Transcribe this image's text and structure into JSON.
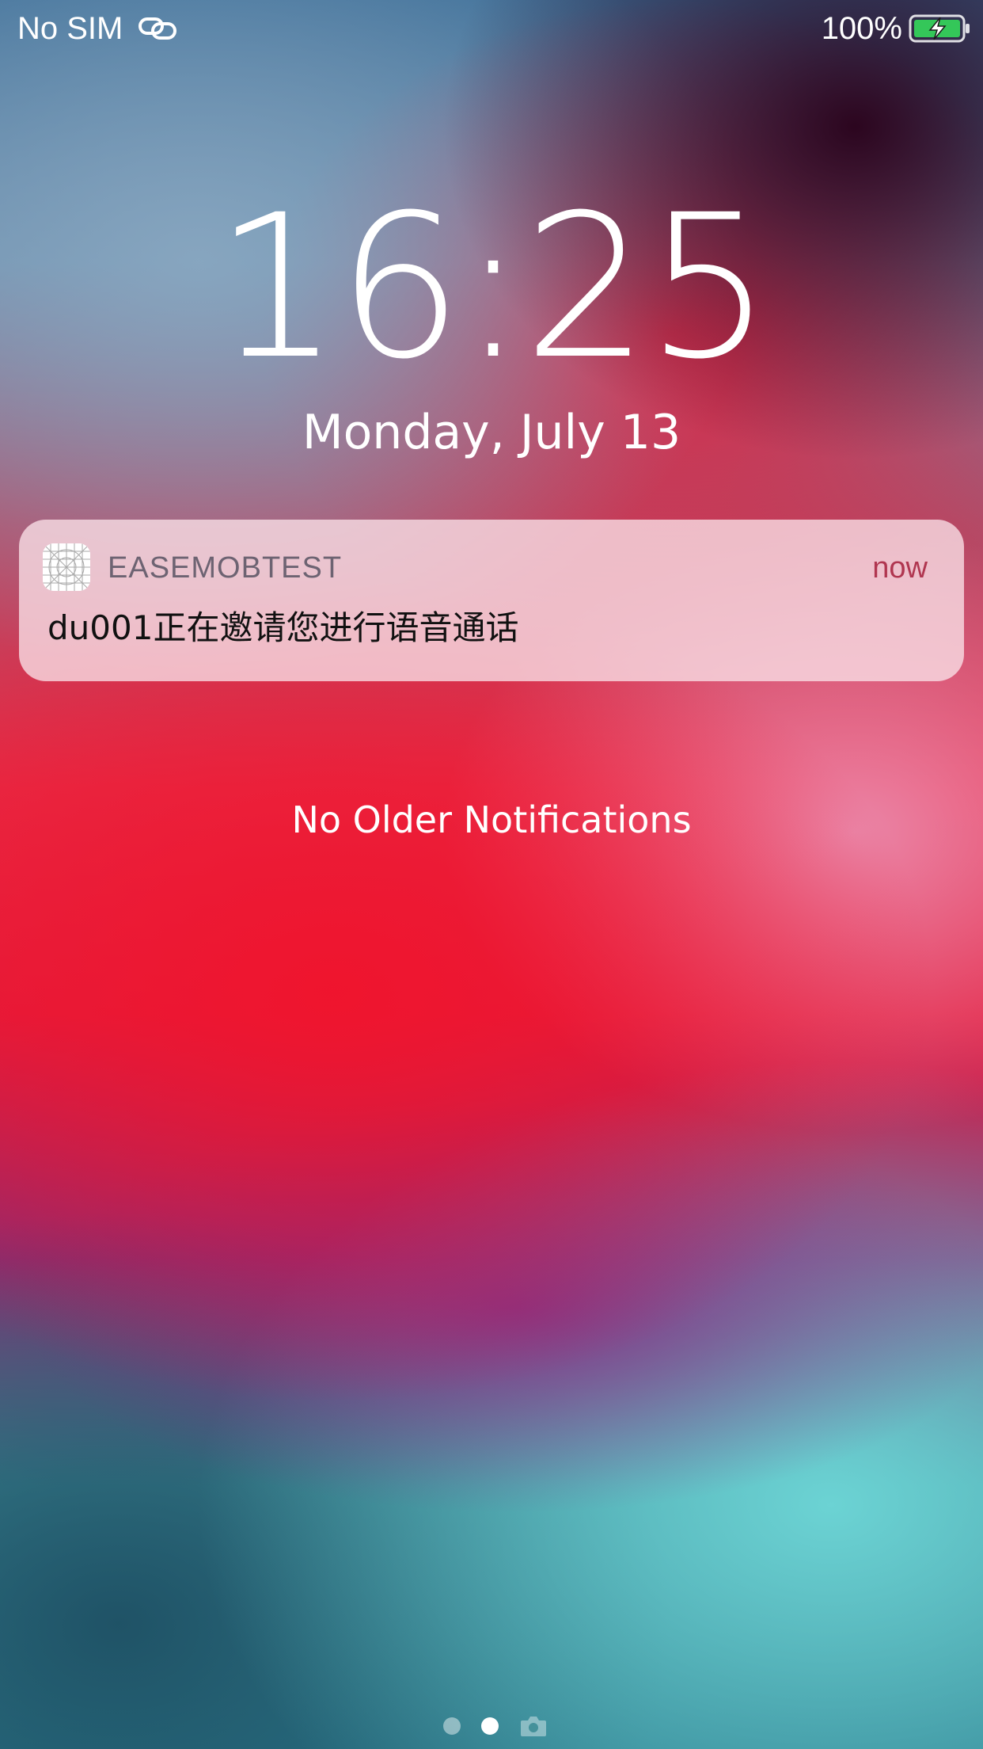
{
  "status_bar": {
    "carrier": "No SIM",
    "battery_percent": "100%",
    "link_icon": "link-icon",
    "battery_icon": "battery-charging-icon",
    "battery_color": "#34c759"
  },
  "lock_screen": {
    "time": "16:25",
    "date": "Monday, July 13"
  },
  "notification": {
    "app_name": "EASEMOBTEST",
    "time": "now",
    "message": "du001正在邀请您进行语音通话",
    "app_icon": "app-placeholder-icon"
  },
  "no_older_notifications": "No Older Notifications",
  "page_indicator": {
    "pages": 3,
    "active_index": 1,
    "last_icon": "camera-icon"
  }
}
